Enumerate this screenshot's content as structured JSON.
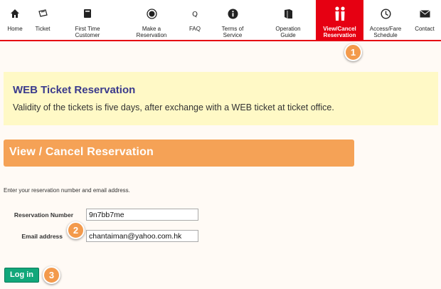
{
  "nav": {
    "items": [
      {
        "label": "Home",
        "icon": "home-icon"
      },
      {
        "label": "Ticket",
        "icon": "ticket-icon"
      },
      {
        "label": "First Time\nCustomer",
        "icon": "book-icon"
      },
      {
        "label": "Make a\nReservation",
        "icon": "record-icon"
      },
      {
        "label": "FAQ",
        "icon": "question-icon"
      },
      {
        "label": "Terms of\nService",
        "icon": "info-icon"
      },
      {
        "label": "Operation\nGuide",
        "icon": "guide-book-icon"
      },
      {
        "label": "View/Cancel\nReservation",
        "icon": "people-icon",
        "active": true
      },
      {
        "label": "Access/Fare\nSchedule",
        "icon": "clock-icon"
      },
      {
        "label": "Contact",
        "icon": "envelope-icon"
      }
    ]
  },
  "badges": {
    "one": "1",
    "two": "2",
    "three": "3"
  },
  "notice": {
    "title": "WEB Ticket Reservation",
    "text": "Validity of the tickets is five days, after exchange with a WEB ticket at ticket office."
  },
  "section": {
    "title": "View / Cancel Reservation"
  },
  "form": {
    "instruction": "Enter your reservation number and email address.",
    "reservation_label": "Reservation Number",
    "reservation_value": "9n7bb7me",
    "email_label": "Email address",
    "email_value": "chantaiman@yahoo.com.hk",
    "login_label": "Log in"
  },
  "colors": {
    "brand_red": "#e60012",
    "orange": "#f5a256",
    "login_green": "#12a77a",
    "notice_yellow": "#fff9c6"
  }
}
